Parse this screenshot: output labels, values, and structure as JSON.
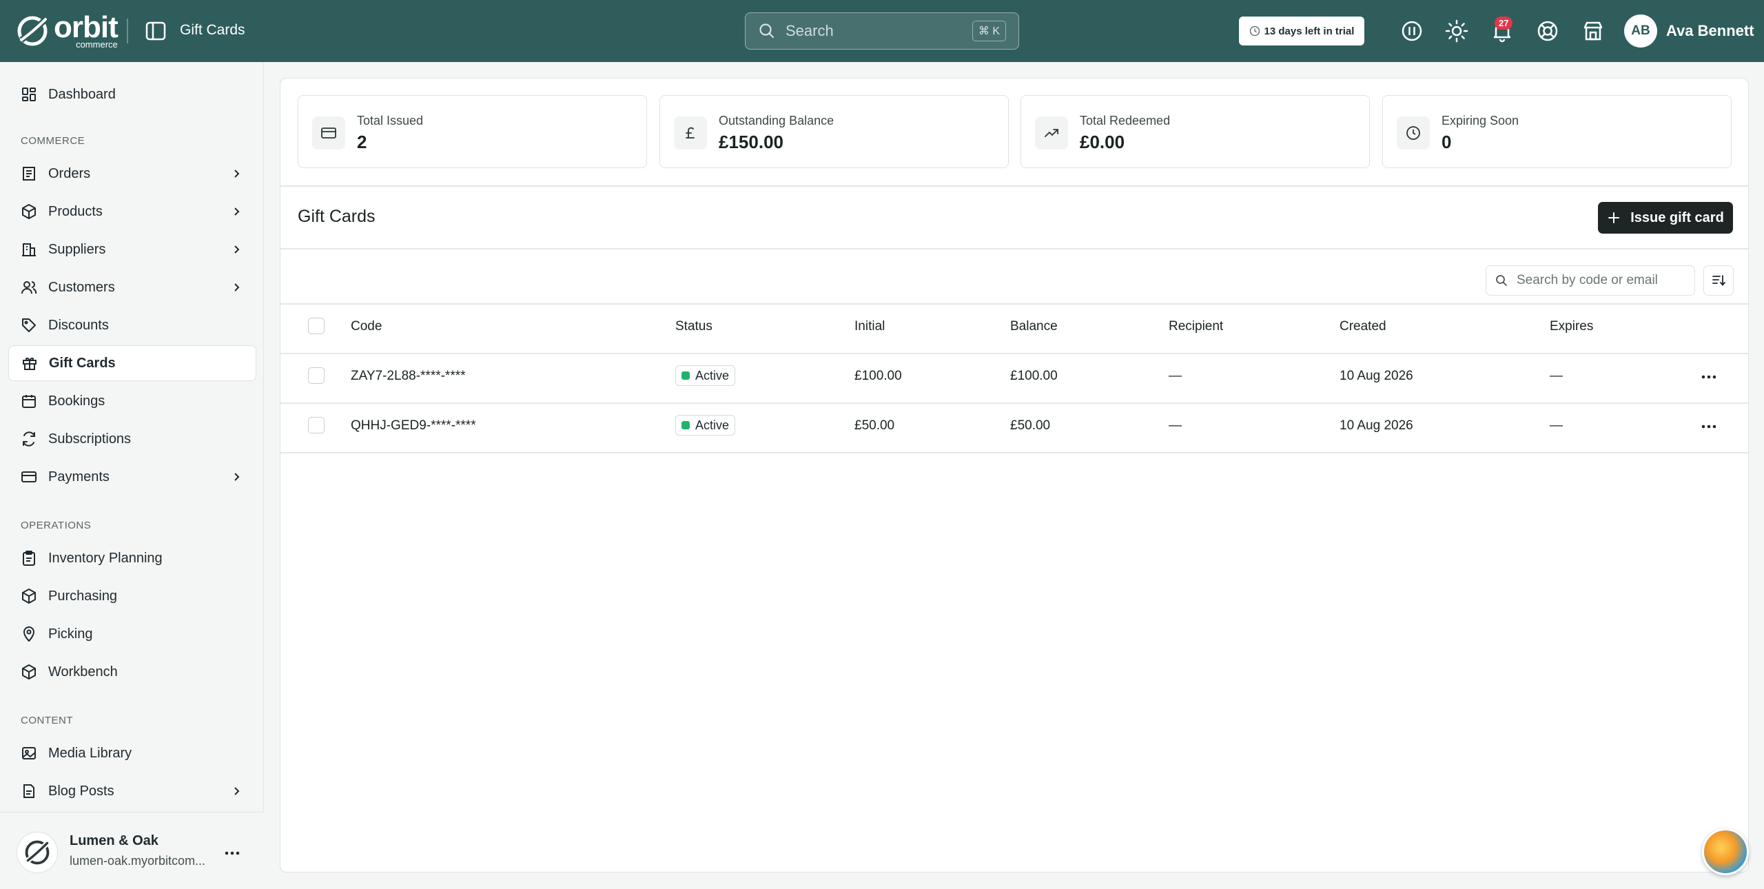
{
  "app": {
    "brand": "orbit",
    "brand_sub": "commerce",
    "page_title": "Gift Cards",
    "search_placeholder": "Search",
    "search_shortcut": "⌘ K",
    "trial_text": "13 days left in trial",
    "notification_count": "27",
    "user_initials": "AB",
    "user_name": "Ava Bennett"
  },
  "sidebar": {
    "top_items": [
      {
        "label": "Dashboard",
        "icon": "dashboard-icon"
      }
    ],
    "sections": [
      {
        "label": "COMMERCE",
        "items": [
          {
            "label": "Orders",
            "icon": "orders-icon",
            "has_children": true
          },
          {
            "label": "Products",
            "icon": "box-icon",
            "has_children": true
          },
          {
            "label": "Suppliers",
            "icon": "building-icon",
            "has_children": true
          },
          {
            "label": "Customers",
            "icon": "users-icon",
            "has_children": true
          },
          {
            "label": "Discounts",
            "icon": "tag-icon",
            "has_children": false
          },
          {
            "label": "Gift Cards",
            "icon": "gift-icon",
            "has_children": false,
            "active": true
          },
          {
            "label": "Bookings",
            "icon": "calendar-icon",
            "has_children": false
          },
          {
            "label": "Subscriptions",
            "icon": "refresh-icon",
            "has_children": false
          },
          {
            "label": "Payments",
            "icon": "card-icon",
            "has_children": true
          }
        ]
      },
      {
        "label": "OPERATIONS",
        "items": [
          {
            "label": "Inventory Planning",
            "icon": "clipboard-icon"
          },
          {
            "label": "Purchasing",
            "icon": "box-icon"
          },
          {
            "label": "Picking",
            "icon": "map-pin-icon"
          },
          {
            "label": "Workbench",
            "icon": "box-icon"
          }
        ]
      },
      {
        "label": "CONTENT",
        "items": [
          {
            "label": "Media Library",
            "icon": "image-icon"
          },
          {
            "label": "Blog Posts",
            "icon": "document-icon",
            "has_children": true
          }
        ]
      }
    ],
    "store": {
      "name": "Lumen & Oak",
      "url": "lumen-oak.myorbitcom..."
    }
  },
  "stats": [
    {
      "label": "Total Issued",
      "value": "2",
      "icon": "card-icon"
    },
    {
      "label": "Outstanding Balance",
      "value": "£150.00",
      "icon": "pound-icon"
    },
    {
      "label": "Total Redeemed",
      "value": "£0.00",
      "icon": "trending-up-icon"
    },
    {
      "label": "Expiring Soon",
      "value": "0",
      "icon": "clock-icon"
    }
  ],
  "main": {
    "heading": "Gift Cards",
    "issue_button": "Issue gift card",
    "table_search_placeholder": "Search by code or email"
  },
  "table": {
    "columns": [
      "Code",
      "Status",
      "Initial",
      "Balance",
      "Recipient",
      "Created",
      "Expires"
    ],
    "rows": [
      {
        "code": "ZAY7-2L88-****-****",
        "status": "Active",
        "initial": "£100.00",
        "balance": "£100.00",
        "recipient": "—",
        "created": "10 Aug 2026",
        "expires": "—"
      },
      {
        "code": "QHHJ-GED9-****-****",
        "status": "Active",
        "initial": "£50.00",
        "balance": "£50.00",
        "recipient": "—",
        "created": "10 Aug 2026",
        "expires": "—"
      }
    ]
  },
  "colors": {
    "topbar": "#2e5d5c",
    "status_active": "#23b26d",
    "badge": "#e2364a",
    "primary_button": "#1f2424"
  }
}
